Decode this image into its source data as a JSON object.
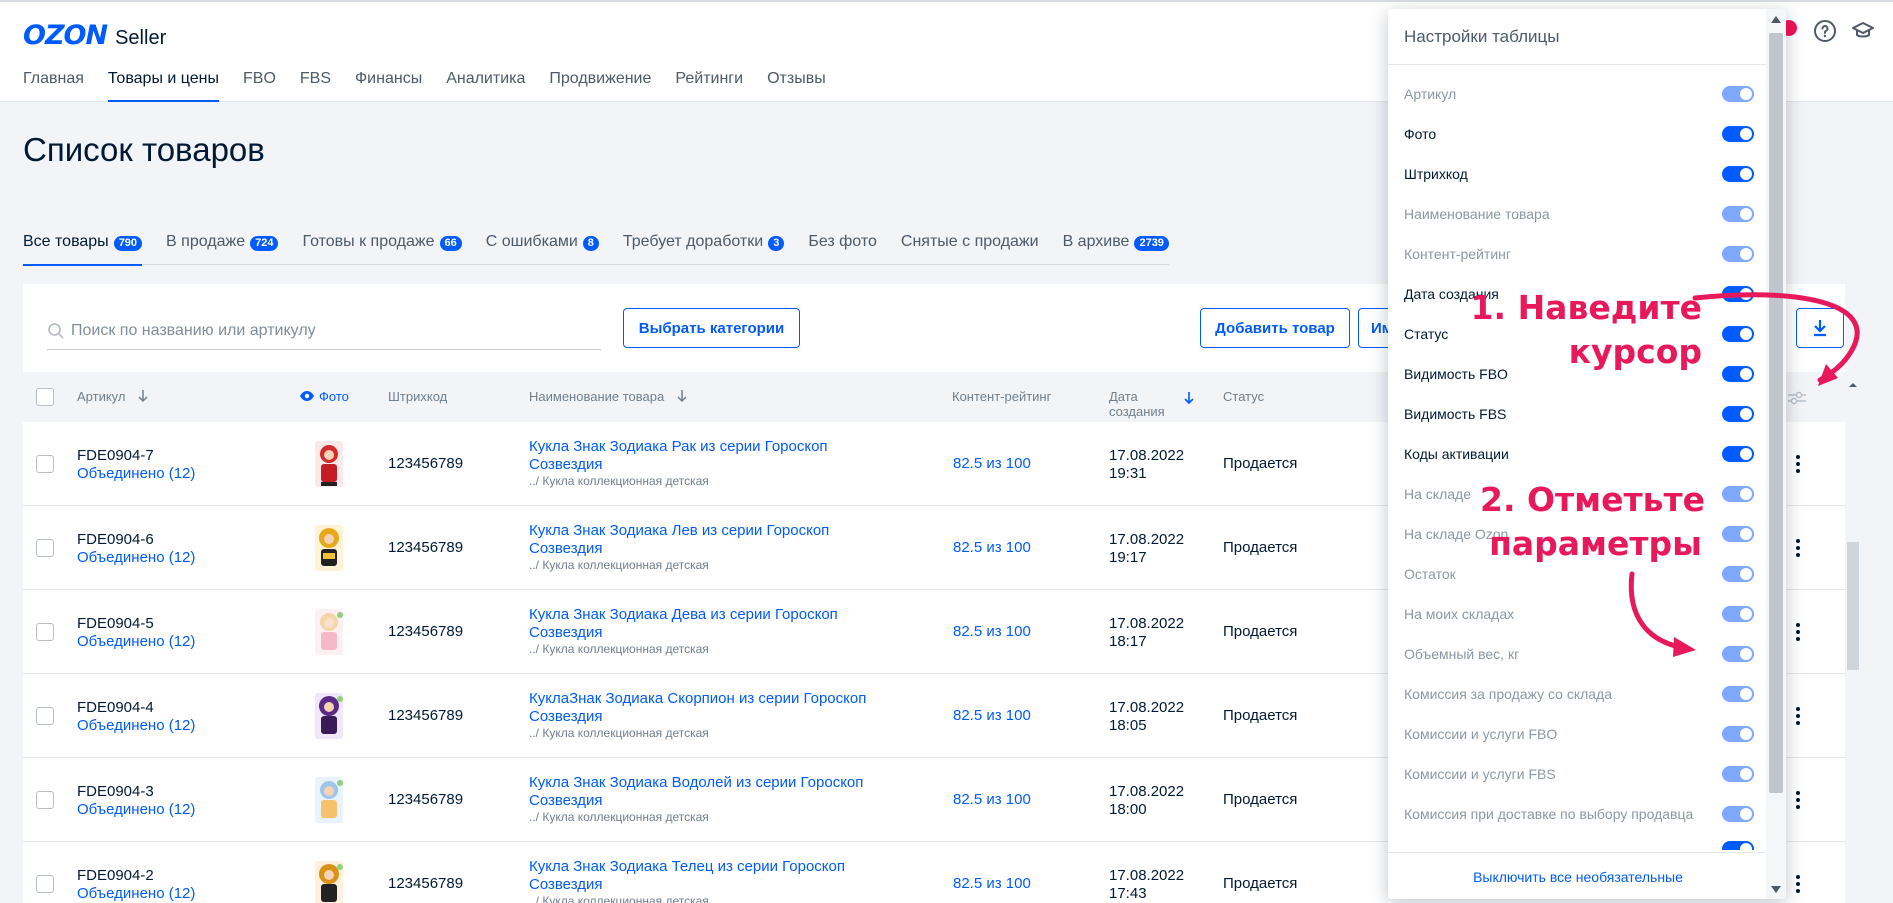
{
  "header": {
    "brand": "OZON",
    "product": "Seller",
    "nav": [
      "Главная",
      "Товары и цены",
      "FBO",
      "FBS",
      "Финансы",
      "Аналитика",
      "Продвижение",
      "Рейтинги",
      "Отзывы"
    ],
    "icons": [
      "notification-icon",
      "help-icon",
      "education-icon"
    ]
  },
  "page": {
    "title": "Список товаров"
  },
  "tabs": [
    {
      "label": "Все товары",
      "count": "790"
    },
    {
      "label": "В продаже",
      "count": "724"
    },
    {
      "label": "Готовы к продаже",
      "count": "66"
    },
    {
      "label": "С ошибками",
      "count": "8"
    },
    {
      "label": "Требует доработки",
      "count": "3"
    },
    {
      "label": "Без фото",
      "count": ""
    },
    {
      "label": "Снятые с продажи",
      "count": ""
    },
    {
      "label": "В архиве",
      "count": "2739"
    }
  ],
  "toolbar": {
    "search_placeholder": "Поиск по названию или артикулу",
    "choose_categories": "Выбрать категории",
    "add_product": "Добавить товар",
    "import_partial": "Им"
  },
  "table": {
    "headers": {
      "article": "Артикул",
      "photo": "Фото",
      "barcode": "Штрихкод",
      "name": "Наименование товара",
      "rating": "Контент-рейтинг",
      "date_line1": "Дата",
      "date_line2": "создания",
      "status": "Статус"
    },
    "rows": [
      {
        "article": "FDE0904-7",
        "merged": "Объединено (12)",
        "barcode": "123456789",
        "name_line1": "Кукла Знак Зодиака Рак из серии Гороскоп",
        "name_line2": "Созвездия",
        "category": "../ Кукла коллекционная детская",
        "rating": "82.5 из 100",
        "date": "17.08.2022",
        "time": "19:31",
        "status": "Продается"
      },
      {
        "article": "FDE0904-6",
        "merged": "Объединено (12)",
        "barcode": "123456789",
        "name_line1": "Кукла Знак Зодиака Лев из серии Гороскоп",
        "name_line2": "Созвездия",
        "category": "../ Кукла коллекционная детская",
        "rating": "82.5 из 100",
        "date": "17.08.2022",
        "time": "19:17",
        "status": "Продается"
      },
      {
        "article": "FDE0904-5",
        "merged": "Объединено (12)",
        "barcode": "123456789",
        "name_line1": "Кукла Знак Зодиака Дева из серии Гороскоп",
        "name_line2": "Созвездия",
        "category": "../ Кукла коллекционная детская",
        "rating": "82.5 из 100",
        "date": "17.08.2022",
        "time": "18:17",
        "status": "Продается"
      },
      {
        "article": "FDE0904-4",
        "merged": "Объединено (12)",
        "barcode": "123456789",
        "name_line1": "КуклаЗнак Зодиака Скорпион из серии Гороскоп",
        "name_line2": "Созвездия",
        "category": "../ Кукла коллекционная детская",
        "rating": "82.5 из 100",
        "date": "17.08.2022",
        "time": "18:05",
        "status": "Продается"
      },
      {
        "article": "FDE0904-3",
        "merged": "Объединено (12)",
        "barcode": "123456789",
        "name_line1": "Кукла Знак Зодиака Водолей из серии Гороскоп",
        "name_line2": "Созвездия",
        "category": "../ Кукла коллекционная детская",
        "rating": "82.5 из 100",
        "date": "17.08.2022",
        "time": "18:00",
        "status": "Продается"
      },
      {
        "article": "FDE0904-2",
        "merged": "Объединено (12)",
        "barcode": "123456789",
        "name_line1": "Кукла Знак Зодиака Телец из серии Гороскоп",
        "name_line2": "Созвездия",
        "category": "../ Кукла коллекционная детская",
        "rating": "82.5 из 100",
        "date": "17.08.2022",
        "time": "17:43",
        "status": "Продается"
      }
    ]
  },
  "settings": {
    "title": "Настройки таблицы",
    "items": [
      {
        "label": "Артикул",
        "enabled": false
      },
      {
        "label": "Фото",
        "enabled": true
      },
      {
        "label": "Штрихкод",
        "enabled": true
      },
      {
        "label": "Наименование товара",
        "enabled": false
      },
      {
        "label": "Контент-рейтинг",
        "enabled": false
      },
      {
        "label": "Дата создания",
        "enabled": true
      },
      {
        "label": "Статус",
        "enabled": true
      },
      {
        "label": "Видимость FBO",
        "enabled": true
      },
      {
        "label": "Видимость FBS",
        "enabled": true
      },
      {
        "label": "Коды активации",
        "enabled": true
      },
      {
        "label": "На складе",
        "enabled": false
      },
      {
        "label": "На складе Ozon",
        "enabled": false
      },
      {
        "label": "Остаток",
        "enabled": false
      },
      {
        "label": "На моих складах",
        "enabled": false
      },
      {
        "label": "Объемный вес, кг",
        "enabled": false
      },
      {
        "label": "Комиссия за продажу со склада",
        "enabled": false
      },
      {
        "label": "Комиссии и услуги FBO",
        "enabled": false
      },
      {
        "label": "Комиссии и услуги FBS",
        "enabled": false
      },
      {
        "label": "Комиссия при доставке по выбору продавца",
        "enabled": false
      }
    ],
    "footer_link": "Выключить все необязательные"
  },
  "annotations": {
    "step1_line1": "1. Наведите",
    "step1_line2": "курсор",
    "step2_line1": "2. Отметьте",
    "step2_line2": "параметры",
    "color": "#e8195a"
  },
  "colors": {
    "accent": "#005bff",
    "text": "#001a34",
    "muted": "#707f8d"
  }
}
